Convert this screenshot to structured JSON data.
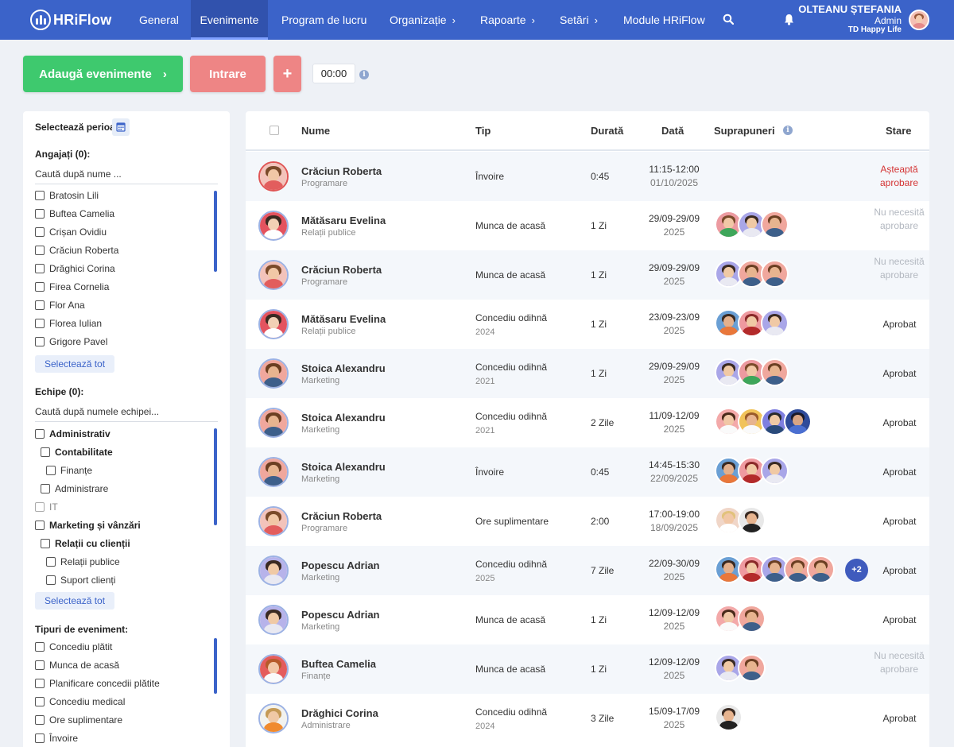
{
  "app": {
    "logo_text": "HRiFlow"
  },
  "nav": {
    "items": [
      {
        "label": "General",
        "has_chevron": false,
        "active": false
      },
      {
        "label": "Evenimente",
        "has_chevron": false,
        "active": true
      },
      {
        "label": "Program de lucru",
        "has_chevron": false,
        "active": false
      },
      {
        "label": "Organizație",
        "has_chevron": true,
        "active": false
      },
      {
        "label": "Rapoarte",
        "has_chevron": true,
        "active": false
      },
      {
        "label": "Setări",
        "has_chevron": true,
        "active": false
      },
      {
        "label": "Module HRiFlow",
        "has_chevron": false,
        "active": false
      }
    ],
    "chevron": "›",
    "search_icon": "search-icon",
    "bell_icon": "bell-icon"
  },
  "user": {
    "name": "OLTEANU ȘTEFANIA",
    "role": "Admin",
    "company": "TD Happy Life"
  },
  "toolbar": {
    "add_events_label": "Adaugă evenimente",
    "add_arrow": "›",
    "entry_label": "Intrare",
    "plus_label": "+",
    "timer_value": "00:00",
    "info_icon": "i"
  },
  "filters": {
    "period_label": "Selectează perioada:",
    "employees": {
      "label": "Angajați (0):",
      "search_placeholder": "Caută după nume ...",
      "items": [
        "Bratosin Lili",
        "Buftea Camelia",
        "Crișan Ovidiu",
        "Crăciun Roberta",
        "Drăghici Corina",
        "Firea Cornelia",
        "Flor Ana",
        "Florea Iulian",
        "Grigore Pavel"
      ],
      "select_all": "Selectează tot"
    },
    "teams": {
      "label": "Echipe (0):",
      "search_placeholder": "Caută după numele echipei...",
      "items": [
        {
          "label": "Administrativ",
          "level": 0,
          "bold": true,
          "muted": false
        },
        {
          "label": "Contabilitate",
          "level": 1,
          "bold": true,
          "muted": false
        },
        {
          "label": "Finanțe",
          "level": 2,
          "bold": false,
          "muted": false
        },
        {
          "label": "Administrare",
          "level": 1,
          "bold": false,
          "muted": false
        },
        {
          "label": "IT",
          "level": 0,
          "bold": false,
          "muted": true
        },
        {
          "label": "Marketing și vânzări",
          "level": 0,
          "bold": true,
          "muted": false
        },
        {
          "label": "Relații cu clienții",
          "level": 1,
          "bold": true,
          "muted": false
        },
        {
          "label": "Relații publice",
          "level": 2,
          "bold": false,
          "muted": false
        },
        {
          "label": "Suport clienți",
          "level": 2,
          "bold": false,
          "muted": false
        }
      ],
      "select_all": "Selectează tot"
    },
    "event_types": {
      "label": "Tipuri de eveniment:",
      "items": [
        "Concediu plătit",
        "Munca de acasă",
        "Planificare concedii plătite",
        "Concediu medical",
        "Ore suplimentare",
        "Învoire"
      ]
    }
  },
  "table": {
    "headers": {
      "name": "Nume",
      "type": "Tip",
      "duration": "Durată",
      "date": "Dată",
      "overlaps": "Suprapuneri",
      "status": "Stare"
    },
    "rows": [
      {
        "name": "Crăciun Roberta",
        "dept": "Programare",
        "type": "Învoire",
        "type_sub": "",
        "duration": "0:45",
        "date1": "11:15-12:00",
        "date2": "01/10/2025",
        "status": "Așteaptă aprobare",
        "status_kind": "pending",
        "overlaps": [],
        "extra": "",
        "avatar": {
          "bg": "#f3c3bb",
          "skin": "#f1c7a6",
          "hair": "#7a4a2a",
          "cloth": "#e25d5d",
          "ring": "red"
        }
      },
      {
        "name": "Mătăsaru Evelina",
        "dept": "Relații publice",
        "type": "Munca de acasă",
        "type_sub": "",
        "duration": "1 Zi",
        "date1": "29/09-29/09",
        "date2": "2025",
        "status": "Nu necesită aprobare",
        "status_kind": "na",
        "overlaps": [
          "a1",
          "a2",
          "a3"
        ],
        "extra": "",
        "avatar": {
          "bg": "#e4535f",
          "skin": "#f2d0b5",
          "hair": "#3a2a22",
          "cloth": "#ffffff",
          "ring": "blue"
        }
      },
      {
        "name": "Crăciun Roberta",
        "dept": "Programare",
        "type": "Munca de acasă",
        "type_sub": "",
        "duration": "1 Zi",
        "date1": "29/09-29/09",
        "date2": "2025",
        "status": "Nu necesită aprobare",
        "status_kind": "na",
        "overlaps": [
          "a2",
          "a3",
          "a4"
        ],
        "extra": "",
        "avatar": {
          "bg": "#f3c3bb",
          "skin": "#f1c7a6",
          "hair": "#7a4a2a",
          "cloth": "#e25d5d",
          "ring": "blue"
        }
      },
      {
        "name": "Mătăsaru Evelina",
        "dept": "Relații publice",
        "type": "Concediu odihnă",
        "type_sub": "2024",
        "duration": "1 Zi",
        "date1": "23/09-23/09",
        "date2": "2025",
        "status": "Aprobat",
        "status_kind": "ok",
        "overlaps": [
          "a5",
          "a6",
          "a7"
        ],
        "extra": "",
        "avatar": {
          "bg": "#e4535f",
          "skin": "#f2d0b5",
          "hair": "#3a2a22",
          "cloth": "#ffffff",
          "ring": "blue"
        }
      },
      {
        "name": "Stoica Alexandru",
        "dept": "Marketing",
        "type": "Concediu odihnă",
        "type_sub": "2021",
        "duration": "1 Zi",
        "date1": "29/09-29/09",
        "date2": "2025",
        "status": "Aprobat",
        "status_kind": "ok",
        "overlaps": [
          "a2",
          "a1",
          "a4"
        ],
        "extra": "",
        "avatar": {
          "bg": "#f0a79d",
          "skin": "#e7b48f",
          "hair": "#6b3f22",
          "cloth": "#3d5f8a",
          "ring": "blue"
        }
      },
      {
        "name": "Stoica Alexandru",
        "dept": "Marketing",
        "type": "Concediu odihnă",
        "type_sub": "2021",
        "duration": "2 Zile",
        "date1": "11/09-12/09",
        "date2": "2025",
        "status": "Aprobat",
        "status_kind": "ok",
        "overlaps": [
          "a8",
          "a9",
          "a10",
          "a11"
        ],
        "extra": "",
        "avatar": {
          "bg": "#f0a79d",
          "skin": "#e7b48f",
          "hair": "#6b3f22",
          "cloth": "#3d5f8a",
          "ring": "blue"
        }
      },
      {
        "name": "Stoica Alexandru",
        "dept": "Marketing",
        "type": "Învoire",
        "type_sub": "",
        "duration": "0:45",
        "date1": "14:45-15:30",
        "date2": "22/09/2025",
        "status": "Aprobat",
        "status_kind": "ok",
        "overlaps": [
          "a5",
          "a6",
          "a7"
        ],
        "extra": "",
        "avatar": {
          "bg": "#f0a79d",
          "skin": "#e7b48f",
          "hair": "#6b3f22",
          "cloth": "#3d5f8a",
          "ring": "blue"
        }
      },
      {
        "name": "Crăciun Roberta",
        "dept": "Programare",
        "type": "Ore suplimentare",
        "type_sub": "",
        "duration": "2:00",
        "date1": "17:00-19:00",
        "date2": "18/09/2025",
        "status": "Aprobat",
        "status_kind": "ok",
        "overlaps": [
          "a12",
          "a13"
        ],
        "extra": "",
        "avatar": {
          "bg": "#f3c3bb",
          "skin": "#f1c7a6",
          "hair": "#7a4a2a",
          "cloth": "#e25d5d",
          "ring": "blue"
        }
      },
      {
        "name": "Popescu Adrian",
        "dept": "Marketing",
        "type": "Concediu odihnă",
        "type_sub": "2025",
        "duration": "7 Zile",
        "date1": "22/09-30/09",
        "date2": "2025",
        "status": "Aprobat",
        "status_kind": "ok",
        "overlaps": [
          "a5",
          "a6",
          "a4b",
          "a4",
          "a3"
        ],
        "extra": "+2",
        "avatar": {
          "bg": "#b7b3ea",
          "skin": "#f0c9a5",
          "hair": "#3a2a22",
          "cloth": "#e9e9f2",
          "ring": "blue"
        }
      },
      {
        "name": "Popescu Adrian",
        "dept": "Marketing",
        "type": "Munca de acasă",
        "type_sub": "",
        "duration": "1 Zi",
        "date1": "12/09-12/09",
        "date2": "2025",
        "status": "Aprobat",
        "status_kind": "ok",
        "overlaps": [
          "a8",
          "a4"
        ],
        "extra": "",
        "avatar": {
          "bg": "#b7b3ea",
          "skin": "#f0c9a5",
          "hair": "#3a2a22",
          "cloth": "#e9e9f2",
          "ring": "blue"
        }
      },
      {
        "name": "Buftea Camelia",
        "dept": "Finanțe",
        "type": "Munca de acasă",
        "type_sub": "",
        "duration": "1 Zi",
        "date1": "12/09-12/09",
        "date2": "2025",
        "status": "Nu necesită aprobare",
        "status_kind": "na",
        "overlaps": [
          "a2",
          "a4"
        ],
        "extra": "",
        "avatar": {
          "bg": "#e45c5c",
          "skin": "#f2c8a8",
          "hair": "#b65a2a",
          "cloth": "#fafafa",
          "ring": "blue"
        }
      },
      {
        "name": "Drăghici Corina",
        "dept": "Administrare",
        "type": "Concediu odihnă",
        "type_sub": "2024",
        "duration": "3 Zile",
        "date1": "15/09-17/09",
        "date2": "2025",
        "status": "Aprobat",
        "status_kind": "ok",
        "overlaps": [
          "a13"
        ],
        "extra": "",
        "avatar": {
          "bg": "#f2f2ee",
          "skin": "#f0c9a5",
          "hair": "#c59a56",
          "cloth": "#f08a2e",
          "ring": "blue"
        }
      }
    ]
  },
  "overlap_avatars": {
    "a1": {
      "bg": "#ec9aa0",
      "skin": "#f1c7a6",
      "hair": "#7a4a2a",
      "cloth": "#3ea65a"
    },
    "a2": {
      "bg": "#a9a6e8",
      "skin": "#f0c9a5",
      "hair": "#3a2a22",
      "cloth": "#e9e9f2"
    },
    "a3": {
      "bg": "#f0a79d",
      "skin": "#e7b48f",
      "hair": "#6b3f22",
      "cloth": "#3d5f8a"
    },
    "a4": {
      "bg": "#f0a79d",
      "skin": "#e7b48f",
      "hair": "#6b3f22",
      "cloth": "#3d5f8a"
    },
    "a4b": {
      "bg": "#a9a6e8",
      "skin": "#e7b48f",
      "hair": "#6b3f22",
      "cloth": "#3d5f8a"
    },
    "a5": {
      "bg": "#6a9fd4",
      "skin": "#e4b08c",
      "hair": "#3a2a22",
      "cloth": "#e9773a"
    },
    "a6": {
      "bg": "#ef9aa0",
      "skin": "#f0c9a5",
      "hair": "#8a2a2a",
      "cloth": "#b32a2a"
    },
    "a7": {
      "bg": "#a9a6e8",
      "skin": "#f0c9a5",
      "hair": "#3a2a22",
      "cloth": "#e9e9f2"
    },
    "a8": {
      "bg": "#f3a9a9",
      "skin": "#f1c7a6",
      "hair": "#4a2a1a",
      "cloth": "#fafafa"
    },
    "a9": {
      "bg": "#f1c35a",
      "skin": "#e7b48f",
      "hair": "#9a5a2a",
      "cloth": "#fafafa"
    },
    "a10": {
      "bg": "#7f7fe0",
      "skin": "#f0c9a5",
      "hair": "#2a2a2a",
      "cloth": "#2a4a7a"
    },
    "a11": {
      "bg": "#2f4b9a",
      "skin": "#d9a584",
      "hair": "#1a1a2a",
      "cloth": "#4b6fd1"
    },
    "a12": {
      "bg": "#f0d6c8",
      "skin": "#f1c7a6",
      "hair": "#e2c27c",
      "cloth": "#ffffff"
    },
    "a13": {
      "bg": "#e8e8e8",
      "skin": "#e7b48f",
      "hair": "#3a2a22",
      "cloth": "#222222"
    }
  },
  "colors": {
    "primary": "#3b63c9",
    "success": "#3ec96e",
    "danger": "#ee8585",
    "pending": "#d43434"
  }
}
